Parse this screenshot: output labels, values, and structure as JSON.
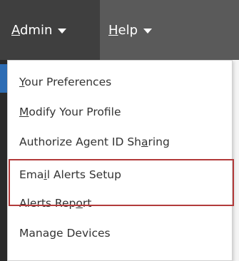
{
  "nav": {
    "admin": {
      "prefix": "",
      "underlined": "A",
      "rest": "dmin"
    },
    "help": {
      "prefix": "",
      "underlined": "H",
      "rest": "elp"
    }
  },
  "menu": {
    "items": [
      {
        "pre": "",
        "u": "Y",
        "post": "our Preferences"
      },
      {
        "pre": "",
        "u": "M",
        "post": "odify Your Profile"
      },
      {
        "pre": "Authorize Agent ID Sh",
        "u": "a",
        "post": "ring"
      },
      {
        "pre": "Ema",
        "u": "i",
        "post": "l Alerts Setup"
      },
      {
        "pre": "Alerts Rep",
        "u": "o",
        "post": "rt"
      },
      {
        "pre": "Manage Devices",
        "u": "",
        "post": ""
      }
    ]
  },
  "colors": {
    "navbar": "#5a5a5a",
    "nav_active": "#3f3f3f",
    "highlight": "#b23a3a",
    "accent": "#2e6db4"
  },
  "icons": {
    "admin_caret": "caret-down-icon",
    "help_caret": "caret-down-icon"
  }
}
